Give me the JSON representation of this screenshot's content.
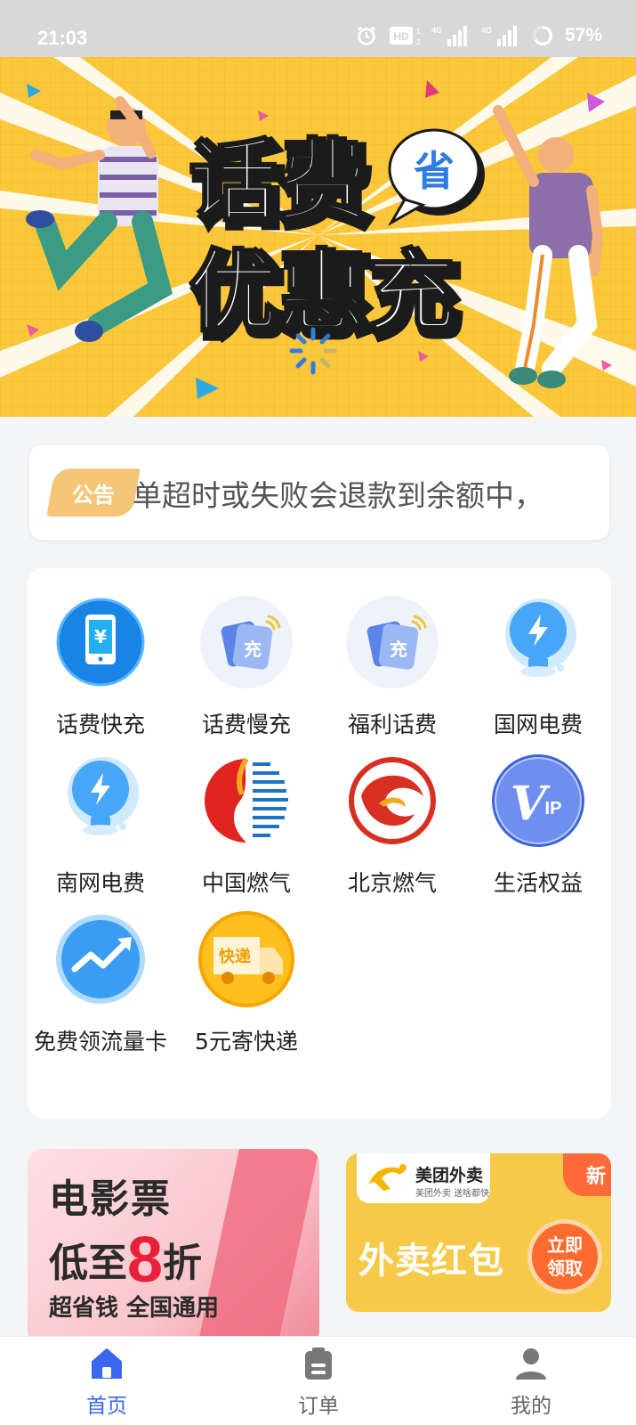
{
  "status_bar": {
    "time": "21:03",
    "battery_percent": "57%",
    "icons": [
      "alarm-icon",
      "hd-icon",
      "signal-4g-icon",
      "signal-4g-icon",
      "battery-ring-icon"
    ]
  },
  "banner": {
    "line1": "话费",
    "line2": "优惠充",
    "badge": "省"
  },
  "notice": {
    "tag": "公告",
    "text": "单超时或失败会退款到余额中，"
  },
  "services": [
    {
      "label": "话费快充",
      "icon": "tablet-yen-icon"
    },
    {
      "label": "话费慢充",
      "icon": "recharge-card-icon"
    },
    {
      "label": "福利话费",
      "icon": "recharge-card-icon"
    },
    {
      "label": "国网电费",
      "icon": "lightning-bulb-icon"
    },
    {
      "label": "南网电费",
      "icon": "lightning-bulb-icon"
    },
    {
      "label": "中国燃气",
      "icon": "china-gas-logo-icon"
    },
    {
      "label": "北京燃气",
      "icon": "beijing-gas-logo-icon"
    },
    {
      "label": "生活权益",
      "icon": "vip-icon"
    },
    {
      "label": "免费领流量卡",
      "icon": "trend-up-icon"
    },
    {
      "label": "5元寄快递",
      "icon": "delivery-truck-icon"
    }
  ],
  "promos": {
    "movie": {
      "line1": "电影票",
      "line2_prefix": "低至",
      "line2_num": "8",
      "line2_suffix": "折",
      "line3": "超省钱 全国通用"
    },
    "waimai": {
      "brand": "美团外卖",
      "slogan": "美团外卖  送啥都快",
      "title": "外卖红包",
      "badge": "新",
      "button": "立即领取"
    }
  },
  "tabbar": {
    "tabs": [
      {
        "label": "首页",
        "icon": "home-icon",
        "active": true
      },
      {
        "label": "订单",
        "icon": "order-icon",
        "active": false
      },
      {
        "label": "我的",
        "icon": "user-icon",
        "active": false
      }
    ]
  },
  "colors": {
    "accent": "#3a66f0",
    "banner_bg": "#fbc83c",
    "notice_tag": "#f5c678"
  }
}
